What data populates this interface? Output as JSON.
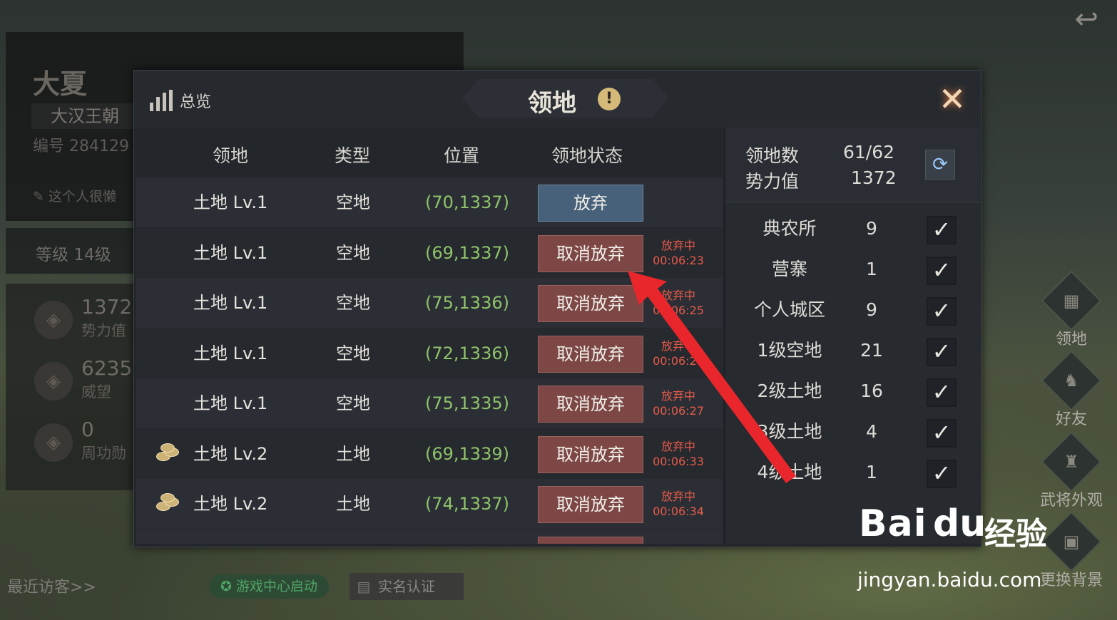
{
  "profile": {
    "nickname": "大夏",
    "dynasty": "大汉王朝",
    "id_text": "编号 284129",
    "signature": "这个人很懒",
    "level": "等级 14级",
    "stats": [
      {
        "value": "1372",
        "label": "势力值"
      },
      {
        "value": "6235",
        "label": "威望"
      },
      {
        "value": "0",
        "label": "周功勋"
      }
    ],
    "visitors": "最近访客>>",
    "game_center": "游戏中心启动",
    "real_name": "实名认证"
  },
  "right_nav": [
    {
      "label": "领地",
      "icon": "territory-icon"
    },
    {
      "label": "好友",
      "icon": "friends-icon"
    },
    {
      "label": "武将外观",
      "icon": "general-appearance-icon"
    },
    {
      "label": "更换背景",
      "icon": "background-icon"
    }
  ],
  "modal": {
    "overview_label": "总览",
    "title": "领地",
    "info_symbol": "!",
    "close_symbol": "✕",
    "columns": [
      "领地",
      "类型",
      "位置",
      "领地状态"
    ],
    "rows": [
      {
        "name": "土地 Lv.1",
        "type": "空地",
        "pos": "(70,1337)",
        "button": "放弃",
        "status_label": "",
        "timer": "",
        "gold": false
      },
      {
        "name": "土地 Lv.1",
        "type": "空地",
        "pos": "(69,1337)",
        "button": "取消放弃",
        "status_label": "放弃中",
        "timer": "00:06:23",
        "gold": false
      },
      {
        "name": "土地 Lv.1",
        "type": "空地",
        "pos": "(75,1336)",
        "button": "取消放弃",
        "status_label": "放弃中",
        "timer": "00:06:25",
        "gold": false
      },
      {
        "name": "土地 Lv.1",
        "type": "空地",
        "pos": "(72,1336)",
        "button": "取消放弃",
        "status_label": "放弃中",
        "timer": "00:06:26",
        "gold": false
      },
      {
        "name": "土地 Lv.1",
        "type": "空地",
        "pos": "(75,1335)",
        "button": "取消放弃",
        "status_label": "放弃中",
        "timer": "00:06:27",
        "gold": false
      },
      {
        "name": "土地 Lv.2",
        "type": "土地",
        "pos": "(69,1339)",
        "button": "取消放弃",
        "status_label": "放弃中",
        "timer": "00:06:33",
        "gold": true
      },
      {
        "name": "土地 Lv.2",
        "type": "土地",
        "pos": "(74,1337)",
        "button": "取消放弃",
        "status_label": "放弃中",
        "timer": "00:06:34",
        "gold": true
      }
    ],
    "summary": {
      "count_label": "领地数",
      "count_value": "61/62",
      "power_label": "势力值",
      "power_value": "1372"
    },
    "categories": [
      {
        "name": "典农所",
        "count": "9",
        "checked": true
      },
      {
        "name": "营寨",
        "count": "1",
        "checked": true
      },
      {
        "name": "个人城区",
        "count": "9",
        "checked": true
      },
      {
        "name": "1级空地",
        "count": "21",
        "checked": true
      },
      {
        "name": "2级土地",
        "count": "16",
        "checked": true
      },
      {
        "name": "3级土地",
        "count": "4",
        "checked": true
      },
      {
        "name": "4级土地",
        "count": "1",
        "checked": true
      }
    ]
  },
  "watermark": {
    "brand": "Bai",
    "brand_du": "du",
    "brand_jy": "经验",
    "url": "jingyan.baidu.com"
  },
  "colors": {
    "abandon_button": "#48617a",
    "cancel_button": "#7d4745",
    "position_text": "#8fc36a",
    "status_text": "#e65a4a",
    "annotation_arrow": "#e8262b"
  }
}
